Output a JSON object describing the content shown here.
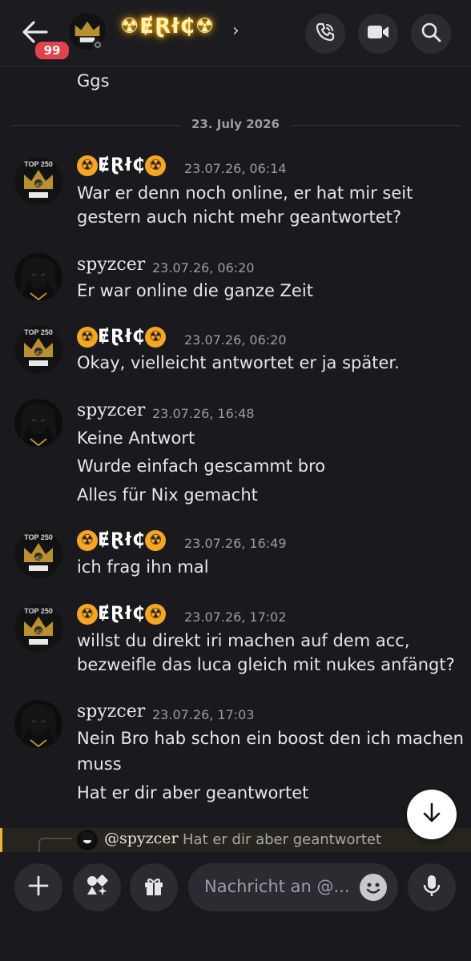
{
  "header": {
    "unread_count": "99",
    "channel_name": "☢ɆⱤł₵☢",
    "chevron": "›",
    "icons": [
      "back-arrow-icon",
      "phone-icon",
      "video-camera-icon",
      "search-icon"
    ]
  },
  "previous_message": {
    "text": "Ggs"
  },
  "date_divider": "23. July 2026",
  "messages": [
    {
      "author": "ɆⱤł₵",
      "timestamp": "23.07.26, 06:14",
      "lines": [
        "War er denn noch online, er hat mir seit",
        "gestern auch nicht mehr geantwortet?"
      ]
    },
    {
      "author": "spyzcer",
      "timestamp": "23.07.26, 06:20",
      "lines": [
        "Er war online die ganze Zeit"
      ]
    },
    {
      "author": "ɆⱤł₵",
      "timestamp": "23.07.26, 06:20",
      "lines": [
        "Okay, vielleicht antwortet er ja später."
      ]
    },
    {
      "author": "spyzcer",
      "timestamp": "23.07.26, 16:48",
      "lines": [
        "Keine Antwort",
        "Wurde einfach gescammt bro",
        "Alles für Nix gemacht"
      ]
    },
    {
      "author": "ɆⱤł₵",
      "timestamp": "23.07.26, 16:49",
      "lines": [
        "ich frag ihn mal"
      ]
    },
    {
      "author": "ɆⱤł₵",
      "timestamp": "23.07.26, 17:02",
      "lines": [
        "willst du direkt iri machen auf dem acc,",
        "bezweifle das luca gleich mit nukes anfängt?"
      ]
    },
    {
      "author": "spyzcer",
      "timestamp": "23.07.26, 17:03",
      "lines": [
        "Nein Bro hab schon ein boost den ich machen",
        "muss",
        "Hat er dir aber geantwortet"
      ]
    }
  ],
  "reply_preview": {
    "mention": "@spyzcer",
    "text": "Hat er dir aber geantwortet"
  },
  "composer": {
    "placeholder": "Nachricht an @..."
  },
  "avatar_text": {
    "top": "TOP 250",
    "badge": "40"
  },
  "radioactive_glyph": "☢",
  "colors": {
    "background": "#1a1a1e",
    "badge": "#e2434b",
    "reply_accent": "#f0b232",
    "name_glow": "#ffb300"
  }
}
